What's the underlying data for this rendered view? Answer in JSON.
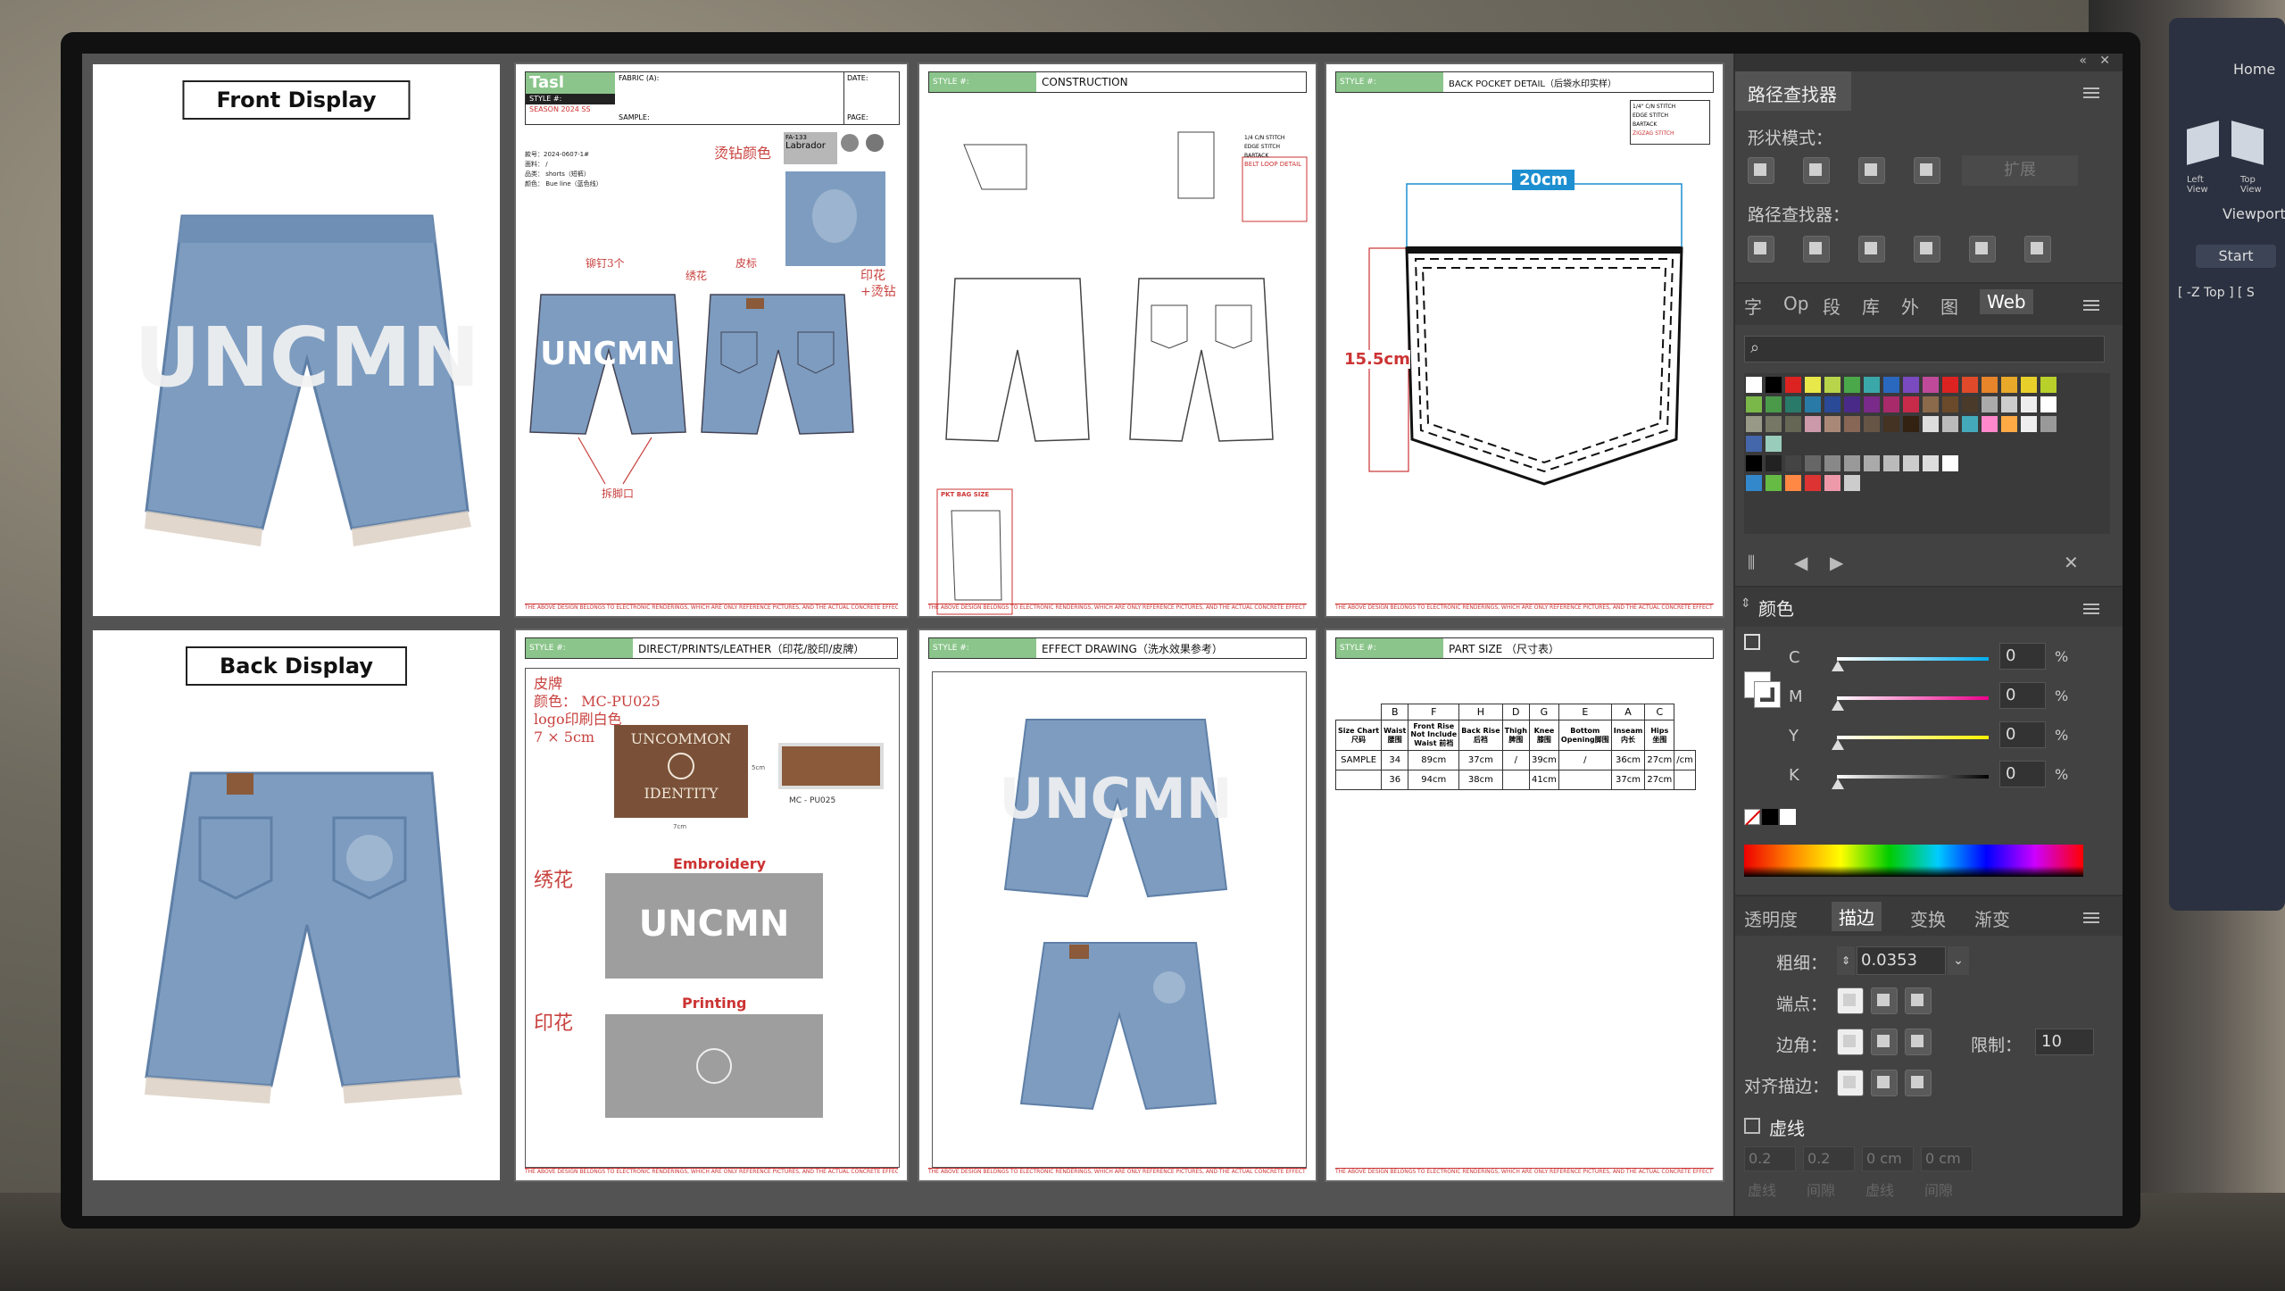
{
  "artboards": {
    "front_label": "Front Display",
    "back_label": "Back Display",
    "uncmn_text": "UNCMN",
    "sheet1": {
      "brand": "Tasl Brand",
      "fabric": "FABRIC (A):",
      "date": "DATE:",
      "style": "STYLE #:",
      "season": "SEASON  2024 SS",
      "sample": "SAMPLE:",
      "page": "PAGE:",
      "info1": "款号：2024-0607-1#",
      "info2": "面料： /",
      "info3": "品类： shorts（短裤）",
      "info4": "颜色： Bue line（蓝色线）",
      "note_rhinestone": "烫钻颜色",
      "note_rivet": "铆钉3个",
      "note_embroidery": "绣花",
      "note_leather": "皮标",
      "note_print": "印花\n+烫钻",
      "note_hem": "拆脚口",
      "color_chip1": "FA-133",
      "color_chip2": "Labrador"
    },
    "sheet2": {
      "tag": "STYLE #:",
      "title": "CONSTRUCTION",
      "legend1": "1/4 C/N STITCH",
      "legend2": "EDGE STITCH",
      "legend3": "BARTACK",
      "belt_loop": "BELT LOOP DETAIL",
      "pkt_bag": "PKT BAG SIZE"
    },
    "sheet3": {
      "tag": "STYLE #:",
      "title": "BACK POCKET DETAIL（后袋水印实样）",
      "legend1": "1/4\" C/N STITCH",
      "legend2": "EDGE STITCH",
      "legend3": "BARTACK",
      "legend4": "ZIGZAG STITCH",
      "width": "20cm",
      "height": "15.5cm"
    },
    "sheet4": {
      "tag": "STYLE #:",
      "title": "DIRECT/PRINTS/LEATHER（印花/胶印/皮牌）",
      "leather_line1": "皮牌",
      "leather_line2": "颜色： MC-PU025",
      "leather_line3": "logo印刷白色",
      "leather_line4": "7 × 5cm",
      "patch_text1": "UNCOMMON",
      "patch_text2": "IDENTITY",
      "chip_code": "MC - PU025",
      "dim_h": "5cm",
      "dim_w": "7cm",
      "embroidery_cn": "绣花",
      "embroidery_en": "Embroidery",
      "print_cn": "印花",
      "print_en": "Printing"
    },
    "sheet5": {
      "tag": "STYLE #:",
      "title": "EFFECT DRAWING（洗水效果参考）"
    },
    "sheet6": {
      "tag": "STYLE #:",
      "title": "PART SIZE （尺寸表）",
      "letters": [
        "B",
        "F",
        "H",
        "D",
        "G",
        "E",
        "A",
        "C"
      ],
      "headers": [
        "Size Chart\n尺码",
        "Waist\n腰围",
        "Front Rise\nNot Include\nWaist 前裆",
        "Back Rise\n后裆",
        "Thigh\n脾围",
        "Knee\n膝围",
        "Bottom\nOpening脚围",
        "Inseam\n内长",
        "Hips\n坐围"
      ],
      "rows": [
        [
          "SAMPLE",
          "34",
          "89cm",
          "37cm",
          "/",
          "39cm",
          "/",
          "36cm",
          "27cm",
          "/cm"
        ],
        [
          "",
          "36",
          "94cm",
          "38cm",
          "",
          "41cm",
          "",
          "37cm",
          "27cm",
          ""
        ]
      ]
    },
    "footer": "THE ABOVE DESIGN BELONGS TO ELECTRONIC RENDERINGS, WHICH ARE ONLY REFERENCE PICTURES, AND THE ACTUAL CONCRETE EFFECT SHOULD BE SUBJECT TO THE REAL THING."
  },
  "panel": {
    "pathfinder_title": "路径查找器",
    "shape_modes": "形状模式：",
    "expand": "扩展",
    "pathfinders": "路径查找器：",
    "tabs": [
      "字",
      "Op",
      "段",
      "库",
      "外",
      "图",
      "Web"
    ],
    "color_title": "颜色",
    "cmyk": [
      {
        "label": "C",
        "value": "0",
        "unit": "%"
      },
      {
        "label": "M",
        "value": "0",
        "unit": "%"
      },
      {
        "label": "Y",
        "value": "0",
        "unit": "%"
      },
      {
        "label": "K",
        "value": "0",
        "unit": "%"
      }
    ],
    "stroke_tabs": [
      "透明度",
      "描边",
      "变换",
      "渐变"
    ],
    "weight_label": "粗细：",
    "weight_value": "0.0353",
    "cap_label": "端点：",
    "corner_label": "边角：",
    "limit_label": "限制：",
    "limit_value": "10",
    "align_label": "对齐描边：",
    "dashed_label": "虚线",
    "dash_values": [
      "0.2",
      "0.2",
      "0 cm",
      "0 cm"
    ],
    "dash_labels": [
      "虚线",
      "间隙",
      "虚线",
      "间隙"
    ]
  },
  "viewport": {
    "home": "Home",
    "left": "Left\nView",
    "top": "Top\nView",
    "viewport": "Viewport",
    "start": "Start",
    "top_label": "[ -Z Top ] [ S"
  },
  "colors": {
    "denim": "#7d9cc0",
    "denim_dark": "#5f7fa6",
    "accent_green": "#8bc58b",
    "note_red": "#c8423f",
    "dim_blue": "#1d8fd0",
    "panel_bg": "#424242"
  }
}
